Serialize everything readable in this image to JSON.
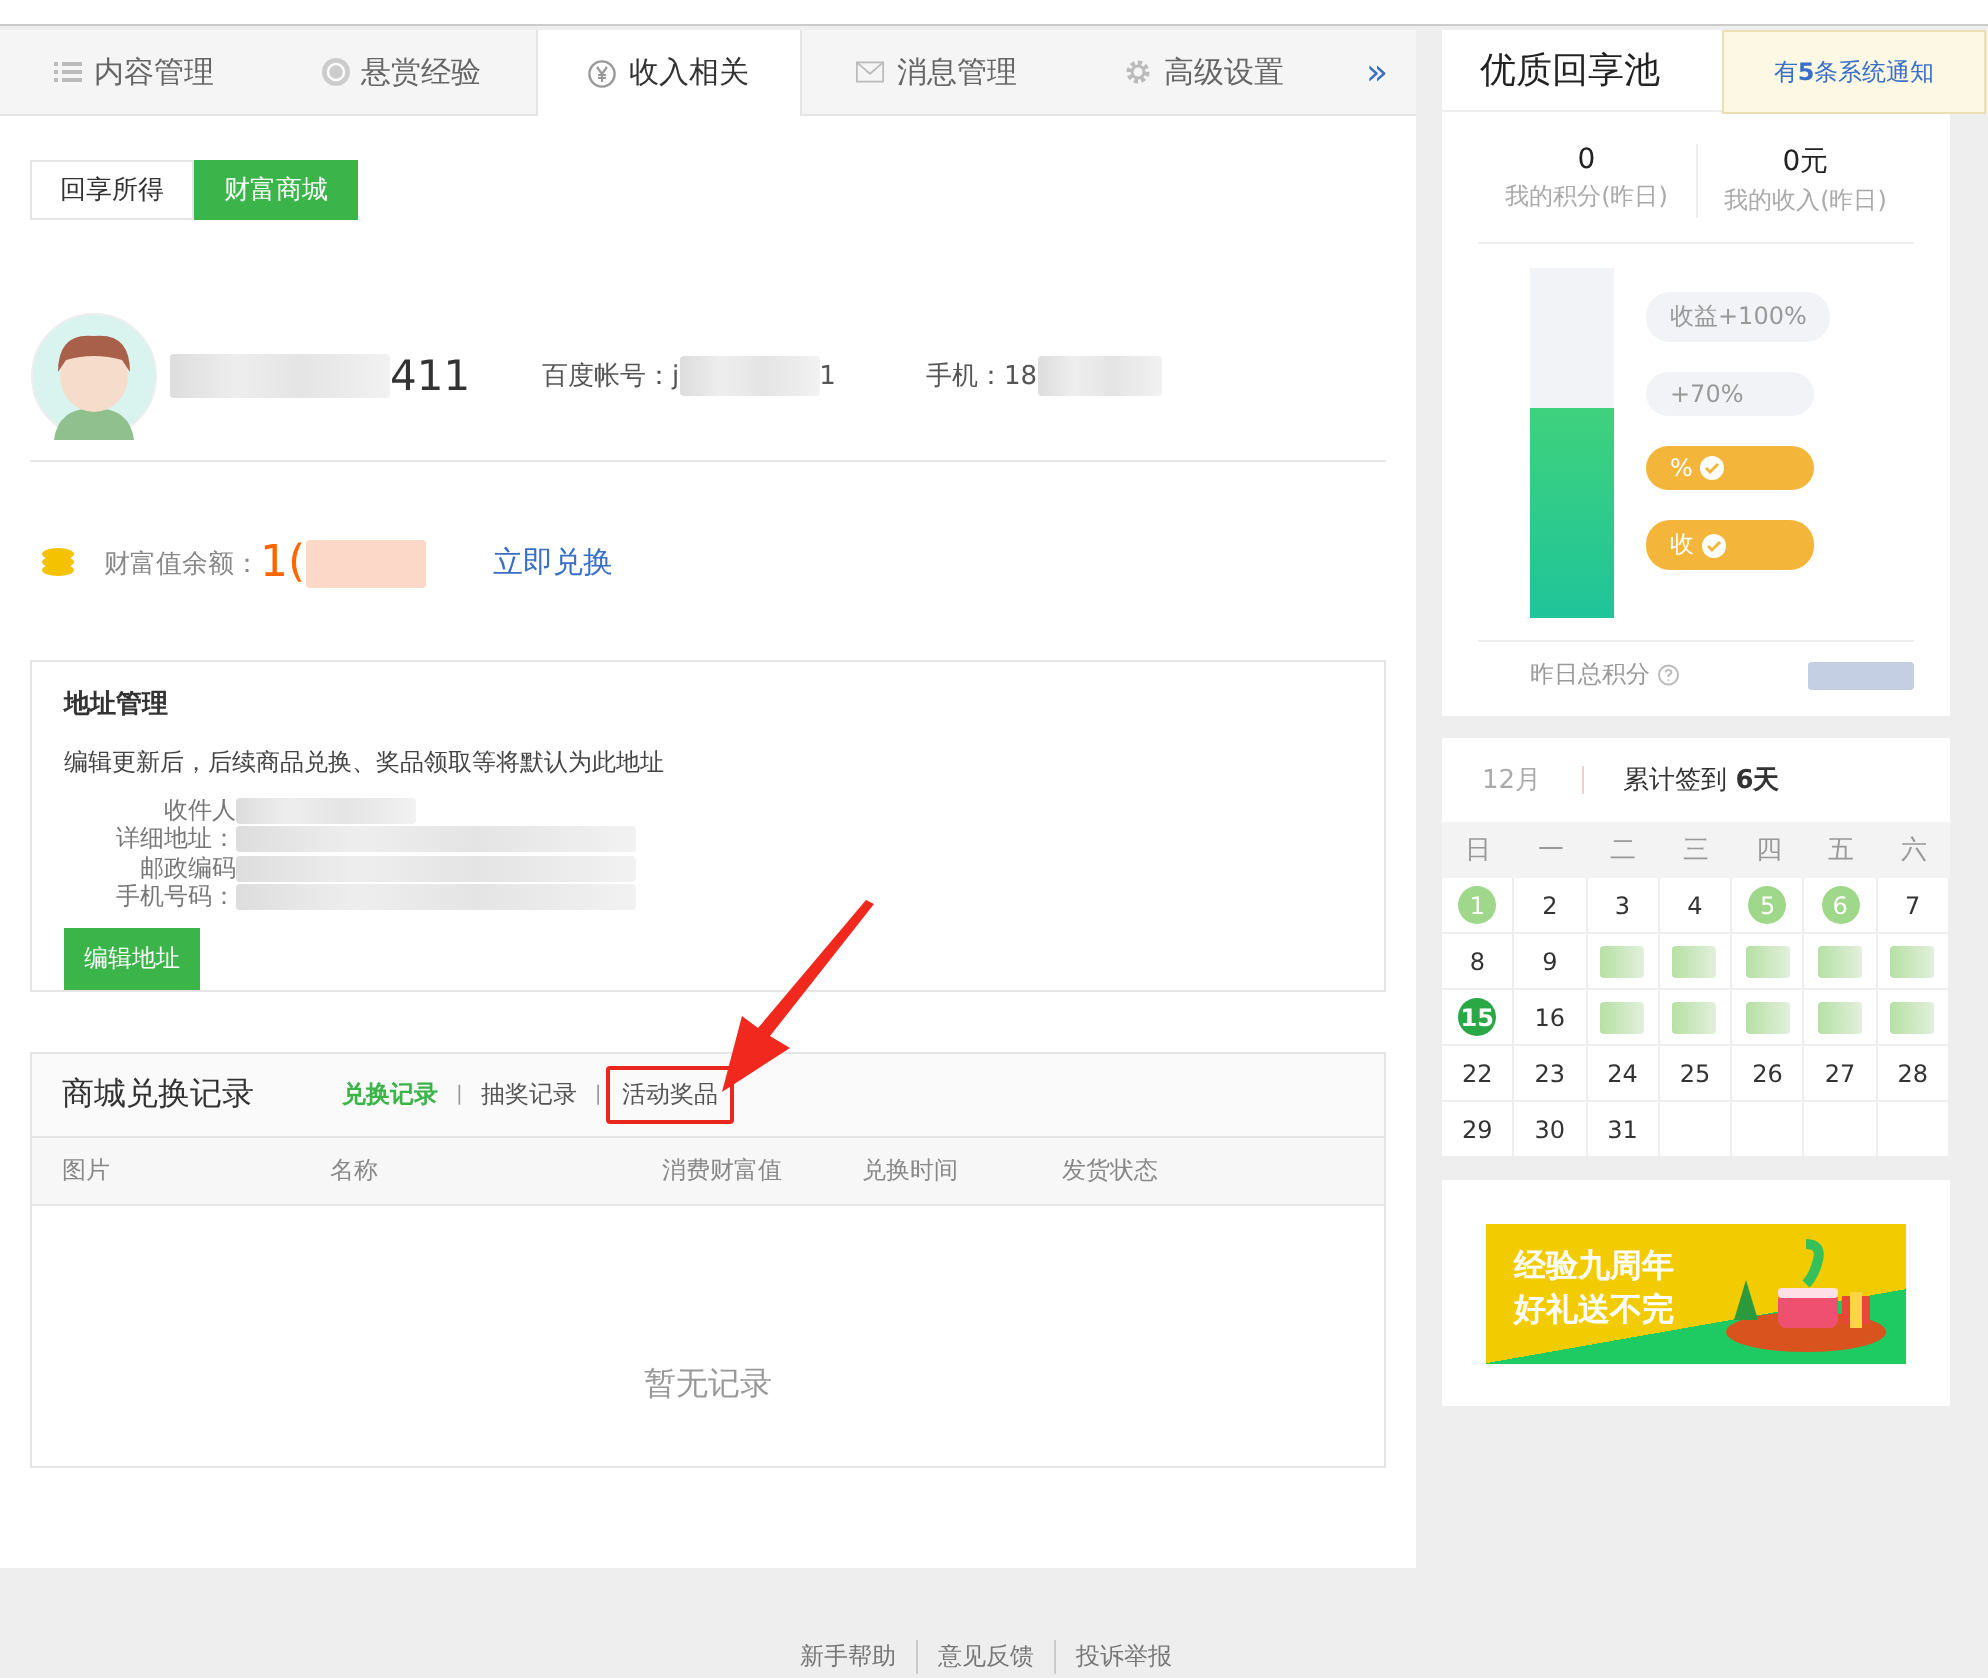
{
  "tabs": [
    {
      "label": "内容管理",
      "selected": false
    },
    {
      "label": "悬赏经验",
      "selected": false
    },
    {
      "label": "收入相关",
      "selected": true
    },
    {
      "label": "消息管理",
      "selected": false
    },
    {
      "label": "高级设置",
      "selected": false
    }
  ],
  "tabs_more": "»",
  "subtabs": [
    {
      "label": "回享所得",
      "selected": false
    },
    {
      "label": "财富商城",
      "selected": true
    }
  ],
  "profile": {
    "name_suffix": "411",
    "account_label": "百度帐号：",
    "account_prefix": "j",
    "account_suffix": "1",
    "phone_label": "手机：",
    "phone_prefix": "18"
  },
  "wealth": {
    "label": "财富值余额：",
    "value_prefix": "1(",
    "link": "立即兑换"
  },
  "address": {
    "title": "地址管理",
    "note": "编辑更新后，后续商品兑换、奖品领取等将默认为此地址",
    "fields": [
      "收件人",
      "详细地址：",
      "邮政编码",
      "手机号码："
    ],
    "button": "编辑地址"
  },
  "records": {
    "title": "商城兑换记录",
    "separator": "|",
    "tabs": [
      {
        "label": "兑换记录",
        "selected": true,
        "highlighted": false
      },
      {
        "label": "抽奖记录",
        "selected": false,
        "highlighted": false
      },
      {
        "label": "活动奖品",
        "selected": false,
        "highlighted": true
      }
    ],
    "columns": [
      "图片",
      "名称",
      "消费财富值",
      "兑换时间",
      "发货状态"
    ],
    "empty": "暂无记录"
  },
  "footer": [
    "新手帮助",
    "意见反馈",
    "投诉举报"
  ],
  "pool": {
    "title": "优质回享池",
    "stats": [
      {
        "value": "0",
        "label": "我的积分(昨日)"
      },
      {
        "value": "0元",
        "label": "我的收入(昨日)"
      }
    ],
    "level": 0.6,
    "bubbles": [
      {
        "text": "收益+100%",
        "reached": false
      },
      {
        "text": "+70%",
        "reached": false
      },
      {
        "text": "%",
        "reached": true
      },
      {
        "text": "收",
        "reached": true
      }
    ],
    "total_label": "昨日总积分"
  },
  "notice": "有**5**条系统通知",
  "calendar": {
    "month": "12月",
    "summary": "累计签到 **6天**",
    "weekdays": [
      "日",
      "一",
      "二",
      "三",
      "四",
      "五",
      "六"
    ],
    "days": [
      {
        "kind": "day",
        "day": "1",
        "signed": true,
        "today": false
      },
      {
        "kind": "day",
        "day": "2",
        "signed": false,
        "today": false
      },
      {
        "kind": "day",
        "day": "3",
        "signed": false,
        "today": false
      },
      {
        "kind": "day",
        "day": "4",
        "signed": false,
        "today": false
      },
      {
        "kind": "day",
        "day": "5",
        "signed": true,
        "today": false
      },
      {
        "kind": "day",
        "day": "6",
        "signed": true,
        "today": false
      },
      {
        "kind": "day",
        "day": "7",
        "signed": false,
        "today": false
      },
      {
        "kind": "day",
        "day": "8",
        "signed": false,
        "today": false
      },
      {
        "kind": "day",
        "day": "9",
        "signed": false,
        "today": false
      },
      {
        "kind": "blurred"
      },
      {
        "kind": "blurred"
      },
      {
        "kind": "blurred"
      },
      {
        "kind": "blurred"
      },
      {
        "kind": "blurred"
      },
      {
        "kind": "day",
        "day": "15",
        "signed": true,
        "today": true
      },
      {
        "kind": "day",
        "day": "16",
        "signed": false,
        "today": false
      },
      {
        "kind": "blurred"
      },
      {
        "kind": "blurred"
      },
      {
        "kind": "blurred"
      },
      {
        "kind": "blurred"
      },
      {
        "kind": "blurred"
      },
      {
        "kind": "day",
        "day": "22",
        "signed": false,
        "today": false
      },
      {
        "kind": "day",
        "day": "23",
        "signed": false,
        "today": false
      },
      {
        "kind": "day",
        "day": "24",
        "signed": false,
        "today": false
      },
      {
        "kind": "day",
        "day": "25",
        "signed": false,
        "today": false
      },
      {
        "kind": "day",
        "day": "26",
        "signed": false,
        "today": false
      },
      {
        "kind": "day",
        "day": "27",
        "signed": false,
        "today": false
      },
      {
        "kind": "day",
        "day": "28",
        "signed": false,
        "today": false
      },
      {
        "kind": "day",
        "day": "29",
        "signed": false,
        "today": false
      },
      {
        "kind": "day",
        "day": "30",
        "signed": false,
        "today": false
      },
      {
        "kind": "day",
        "day": "31",
        "signed": false,
        "today": false
      },
      {
        "kind": "empty"
      },
      {
        "kind": "empty"
      },
      {
        "kind": "empty"
      },
      {
        "kind": "empty"
      }
    ]
  },
  "banner": {
    "lines": [
      "经验九周年",
      "好礼送不完"
    ]
  }
}
